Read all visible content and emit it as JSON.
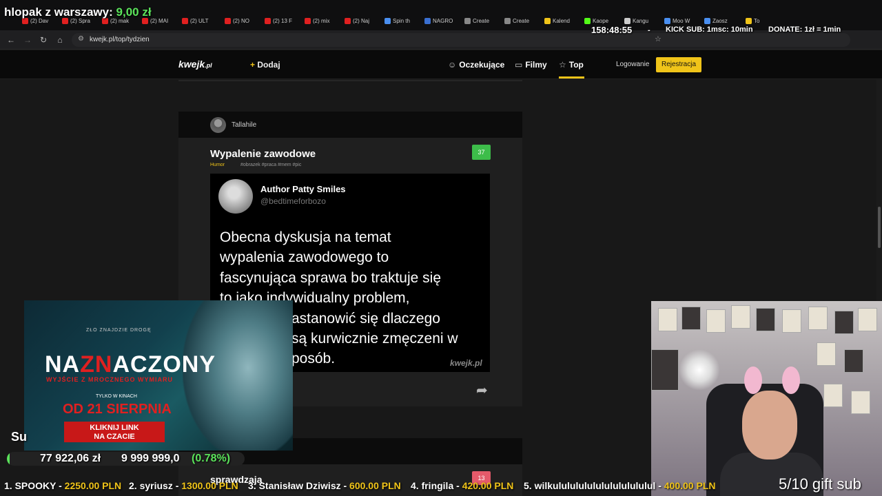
{
  "overlay": {
    "title_text": "hlopak z warszawy:",
    "title_amount": "9,00 zł",
    "timer": "158:48:55",
    "kick_sub": "KICK SUB: 1msc: 10min",
    "donate": "DONATE: 1zł = 1min",
    "gift_sub": "5/10 gift sub",
    "su_label": "Su",
    "goal_current": "77 922,06 zł",
    "goal_target": "9 999 999,0",
    "goal_percent": "(0.78%)",
    "goal_progress": 0.0078
  },
  "browser": {
    "url": "kwejk.pl/top/tydzien",
    "tabs": [
      {
        "label": "(2) Dav",
        "color": "#e02020"
      },
      {
        "label": "(2) Spra",
        "color": "#e02020"
      },
      {
        "label": "(2) mak",
        "color": "#e02020"
      },
      {
        "label": "(2) MAI",
        "color": "#e02020"
      },
      {
        "label": "(2) ULT",
        "color": "#e02020"
      },
      {
        "label": "(2) NO",
        "color": "#e02020"
      },
      {
        "label": "(2) 13 F",
        "color": "#e02020"
      },
      {
        "label": "(2) mix",
        "color": "#e02020"
      },
      {
        "label": "(2) Naj",
        "color": "#e02020"
      },
      {
        "label": "Spin th",
        "color": "#4a8ff0"
      },
      {
        "label": "NAGRO",
        "color": "#3a6fd0"
      },
      {
        "label": "Create",
        "color": "#888888"
      },
      {
        "label": "Create",
        "color": "#888888"
      },
      {
        "label": "Kalend",
        "color": "#f0c419"
      },
      {
        "label": "Kaope",
        "color": "#53fc18"
      },
      {
        "label": "Kangu",
        "color": "#cccccc"
      },
      {
        "label": "Moo W",
        "color": "#4a8ff0"
      },
      {
        "label": "Zaosz",
        "color": "#4a8ff0"
      },
      {
        "label": "To",
        "color": "#f0c419"
      }
    ]
  },
  "site": {
    "logo": "kwejk",
    "logo_suffix": ".pl",
    "add_icon": "+",
    "add_label": "Dodaj",
    "nav": {
      "pending": "Oczekujące",
      "movies": "Filmy",
      "top": "Top"
    },
    "login": "Logowanie",
    "register": "Rejestracja"
  },
  "post": {
    "author": "Tallahile",
    "title": "Wypalenie zawodowe",
    "category": "Humor",
    "tags": "#obrazek #praca #mem #pic",
    "score": "37",
    "tweet_name": "Author Patty Smiles",
    "tweet_handle": "@bedtimeforbozo",
    "tweet_lines": [
      "Obecna dyskusja na temat",
      "wypalenia zawodowego to",
      "fascynująca sprawa bo traktuje się",
      "to jako indywidualny problem,",
      "astanowić się dlaczego",
      "są kurwicznie zmęczeni w",
      "posób."
    ],
    "watermark": "kwejk.pl"
  },
  "post2": {
    "title": "sprawdzaja",
    "score": "13"
  },
  "ad": {
    "small": "ZŁO ZNAJDZIE DROGĘ",
    "title_a": "NA",
    "title_b": "ZN",
    "title_c": "ACZONY",
    "subtitle": "WYJŚCIE Z MROCZNEGO WYMIARU",
    "kino": "TYLKO W KINACH",
    "date": "OD 21 SIERPNIA",
    "btn_line1": "KLIKNIJ LINK",
    "btn_line2": "NA CZACIE"
  },
  "ticker": [
    {
      "name": "1. SPOOKY - ",
      "amount": "2250.00 PLN"
    },
    {
      "name": "2. syriusz - ",
      "amount": "1300.00 PLN"
    },
    {
      "name": "3. Stanisław Dziwisz - ",
      "amount": "600.00 PLN"
    },
    {
      "name": "4. fringila - ",
      "amount": "420.00 PLN"
    },
    {
      "name": "5. wilkulululululululululululul - ",
      "amount": "400.00 PLN"
    }
  ]
}
